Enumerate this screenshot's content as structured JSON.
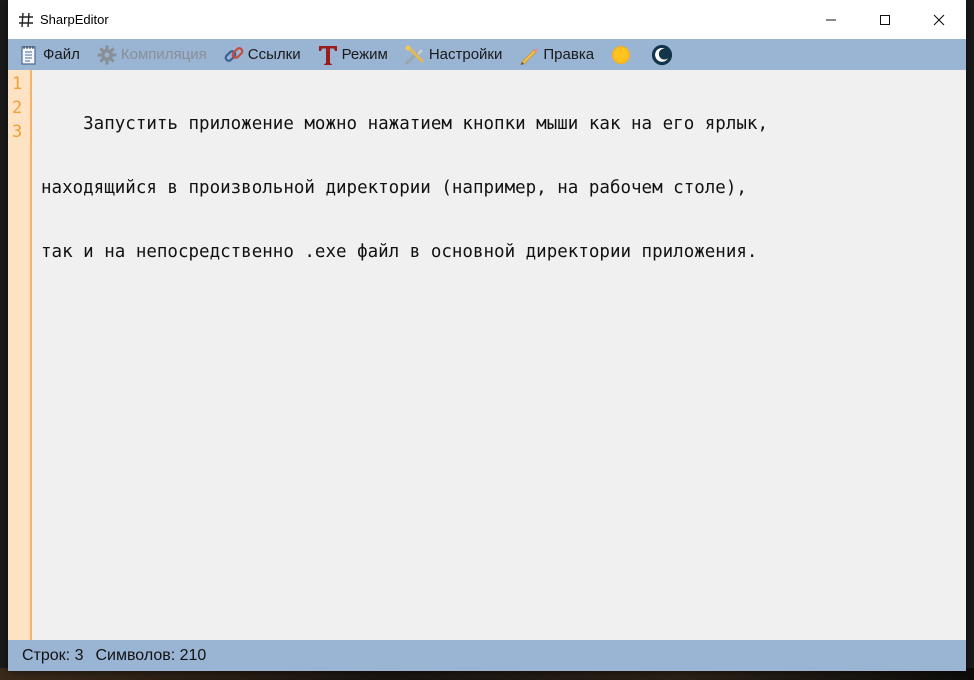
{
  "window": {
    "title": "SharpEditor"
  },
  "menu": {
    "items": [
      {
        "label": "Файл",
        "icon": "notepad-icon",
        "enabled": true
      },
      {
        "label": "Компиляция",
        "icon": "gear-icon",
        "enabled": false
      },
      {
        "label": "Ссылки",
        "icon": "link-icon",
        "enabled": true
      },
      {
        "label": "Режим",
        "icon": "text-mode-icon",
        "enabled": true
      },
      {
        "label": "Настройки",
        "icon": "tools-icon",
        "enabled": true
      },
      {
        "label": "Правка",
        "icon": "pencil-icon",
        "enabled": true
      }
    ],
    "theme_light_icon": "sun-icon",
    "theme_dark_icon": "moon-icon"
  },
  "editor": {
    "line_numbers": [
      "1",
      "2",
      "3"
    ],
    "lines": [
      "    Запустить приложение можно нажатием кнопки мыши как на его ярлык,",
      "находящийся в произвольной директории (например, на рабочем столе),",
      "так и на непосредственно .exe файл в основной директории приложения."
    ]
  },
  "status": {
    "lines_label": "Строк: 3",
    "chars_label": "Символов: 210"
  },
  "colors": {
    "menubar": "#9ab5d4",
    "gutter": "#fde2c4",
    "line_number": "#f2a036"
  }
}
